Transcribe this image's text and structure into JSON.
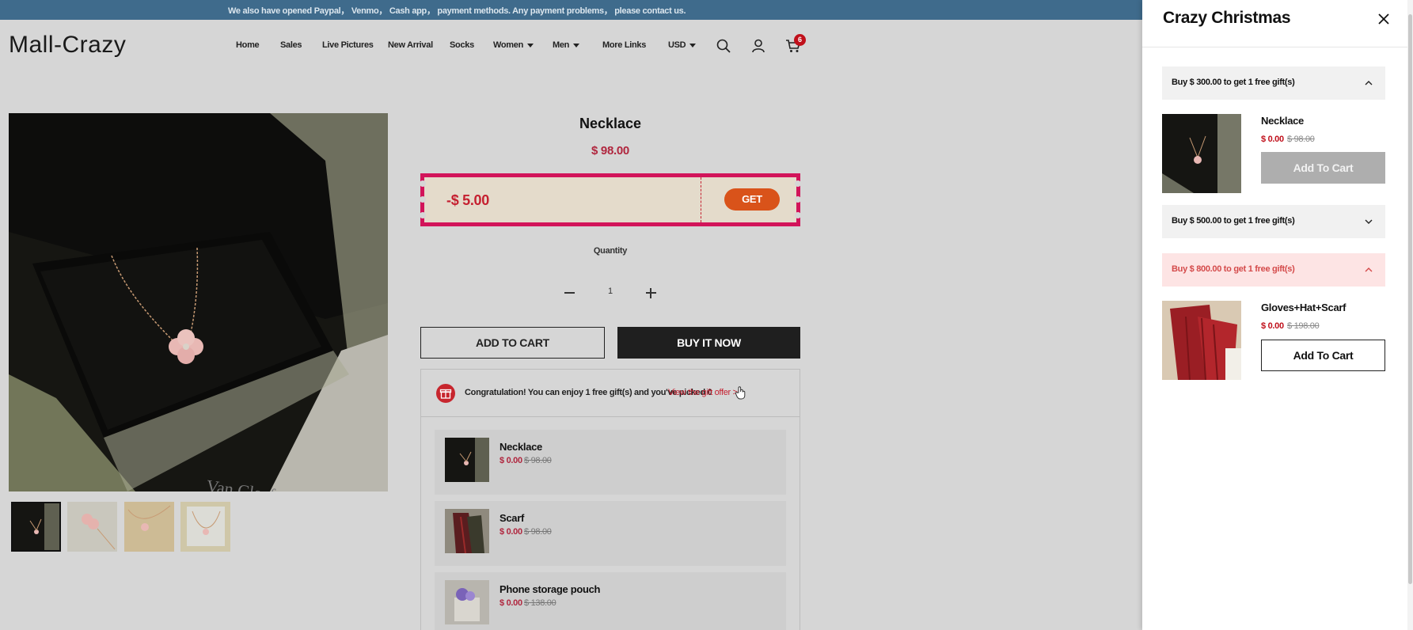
{
  "announcement": "We also have opened Paypal， Venmo， Cash app， payment methods. Any payment problems， please contact us.",
  "header": {
    "logo": "Mall-Crazy",
    "nav": [
      "Home",
      "Sales",
      "Live Pictures",
      "New Arrival",
      "Socks",
      "Women",
      "Men",
      "More Links"
    ],
    "currency": "USD",
    "cart_count": "6",
    "icons": [
      "search-icon",
      "account-icon",
      "cart-icon"
    ]
  },
  "product": {
    "title": "Necklace",
    "price": "$ 98.00",
    "coupon": {
      "amount": "-$ 5.00",
      "button": "GET"
    },
    "quantity_label": "Quantity",
    "quantity": "1",
    "add_to_cart": "ADD TO CART",
    "buy_now": "BUY IT NOW"
  },
  "gift_panel": {
    "message": "Congratulation! You can enjoy 1 free gift(s) and you've picked 0",
    "link": "View the gift offer >>",
    "items": [
      {
        "name": "Necklace",
        "price": "$ 0.00",
        "original": "$ 98.00"
      },
      {
        "name": "Scarf",
        "price": "$ 0.00",
        "original": "$ 98.00"
      },
      {
        "name": "Phone storage pouch",
        "price": "$ 0.00",
        "original": "$ 138.00"
      }
    ]
  },
  "drawer": {
    "title": "Crazy Christmas",
    "tiers": [
      {
        "label": "Buy $ 300.00 to get 1 free gift(s)",
        "expanded": true
      },
      {
        "label": "Buy $ 500.00 to get 1 free gift(s)",
        "expanded": false
      },
      {
        "label": "Buy $ 800.00 to get 1 free gift(s)",
        "expanded": true
      }
    ],
    "items": [
      {
        "name": "Necklace",
        "price": "$ 0.00",
        "original": "$ 98.00",
        "button": "Add To Cart",
        "state": "disabled"
      },
      {
        "name": "Gloves+Hat+Scarf",
        "price": "$ 0.00",
        "original": "$ 198.00",
        "button": "Add To Cart",
        "state": "enabled"
      }
    ]
  },
  "colors": {
    "accent_red": "#c52030",
    "coupon_border": "#d2145a",
    "get_button": "#d9531a",
    "announce_bar": "#3f6b8c"
  }
}
